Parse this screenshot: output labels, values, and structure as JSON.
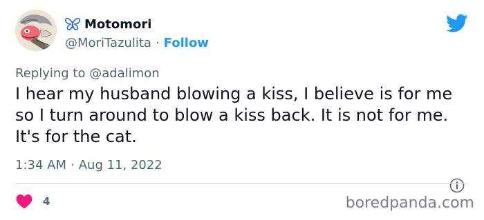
{
  "user": {
    "display_name": "Motomori",
    "handle": "@MoriTazulita",
    "separator": "·",
    "follow_label": "Follow"
  },
  "reply": {
    "prefix": "Replying to",
    "mention": "@adalimon"
  },
  "tweet": {
    "text": "I hear my husband blowing a kiss, I believe is for me so I turn around to blow a kiss back. It is not for me. It's for the cat.",
    "time": "1:34 AM",
    "date_separator": "·",
    "date": "Aug 11, 2022",
    "like_count": "4"
  },
  "watermark": "boredpanda.com",
  "colors": {
    "accent": "#1d9bf0",
    "heart": "#f91880",
    "muted_text": "#536471",
    "butterfly": "#2b6fd6"
  },
  "icons": {
    "platform": "twitter-bird-icon",
    "name_emoji": "butterfly-icon",
    "info": "info-icon",
    "like": "heart-icon"
  }
}
